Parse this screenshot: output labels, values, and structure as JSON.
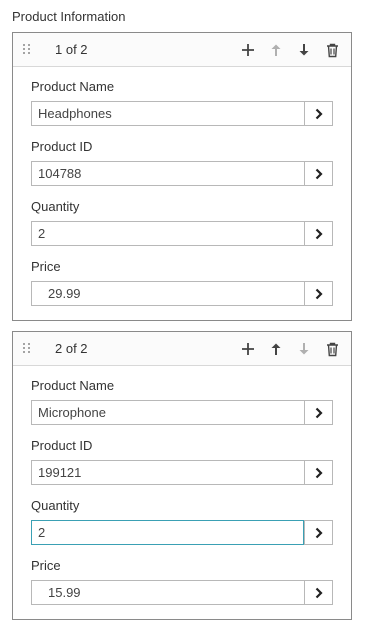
{
  "section": {
    "title": "Product Information"
  },
  "panels": [
    {
      "counter": "1 of 2",
      "fields": {
        "name": {
          "label": "Product Name",
          "value": "Headphones"
        },
        "id": {
          "label": "Product ID",
          "value": "104788"
        },
        "quantity": {
          "label": "Quantity",
          "value": "2"
        },
        "price": {
          "label": "Price",
          "value": "29.99"
        }
      },
      "toolbar": {
        "add_icon": "plus-icon",
        "up_icon": "arrow-up-icon",
        "down_icon": "arrow-down-icon",
        "delete_icon": "trash-icon",
        "up_enabled": false,
        "down_enabled": true
      }
    },
    {
      "counter": "2 of 2",
      "fields": {
        "name": {
          "label": "Product Name",
          "value": "Microphone"
        },
        "id": {
          "label": "Product ID",
          "value": "199121"
        },
        "quantity": {
          "label": "Quantity",
          "value": "2"
        },
        "price": {
          "label": "Price",
          "value": "15.99"
        }
      },
      "toolbar": {
        "add_icon": "plus-icon",
        "up_icon": "arrow-up-icon",
        "down_icon": "arrow-down-icon",
        "delete_icon": "trash-icon",
        "up_enabled": true,
        "down_enabled": false
      }
    }
  ],
  "colors": {
    "border": "#8a8a8a",
    "focus": "#3aa0b4",
    "icon": "#444444",
    "icon_disabled": "#b0b0b0"
  }
}
